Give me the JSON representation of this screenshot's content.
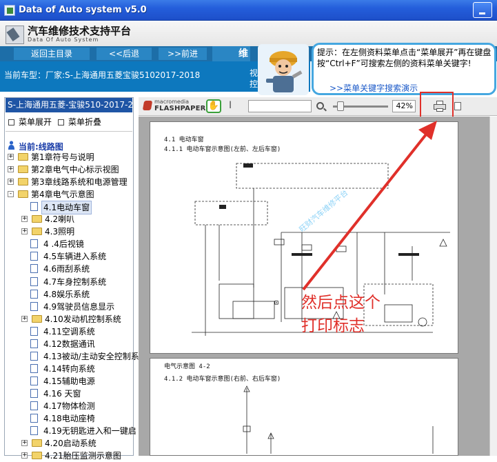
{
  "window": {
    "title": "Data of Auto system v5.0"
  },
  "brand": {
    "title_cn": "汽车维修技术支持平台",
    "title_en": "Data Of Auto System"
  },
  "nav": {
    "home": "返回主目录",
    "back": "<<后退",
    "forward": ">>前进",
    "header_word": "维修"
  },
  "model_line": "当前车型：厂家:S-上海通用五菱宝骏5102017-2018",
  "view_fragment": "视控",
  "tip": {
    "text": "提示：在左侧资料菜单点击“菜单展开”再在键盘按“Ctrl+F”可搜索左侧的资料菜单关键字!",
    "link": ">>菜单关键字搜索演示"
  },
  "left": {
    "header": "S-上海通用五菱-宝骏510-2017-2018",
    "menu_expand": "菜单展开",
    "menu_collapse": "菜单折叠",
    "current": "当前:线路图",
    "tree": [
      {
        "label": "第1章符号与说明",
        "type": "folder",
        "level": 0,
        "exp": "+"
      },
      {
        "label": "第2章电气中心标示视图",
        "type": "folder",
        "level": 0,
        "exp": "+"
      },
      {
        "label": "第3章线路系统和电源管理",
        "type": "folder",
        "level": 0,
        "exp": "+"
      },
      {
        "label": "第4章电气示意图",
        "type": "folder",
        "level": 0,
        "exp": "-"
      },
      {
        "label": "4.1电动车窗",
        "type": "doc",
        "level": 1,
        "selected": true
      },
      {
        "label": "4.2喇叭",
        "type": "folder",
        "level": 1,
        "exp": "+"
      },
      {
        "label": "4.3照明",
        "type": "folder",
        "level": 1,
        "exp": "+"
      },
      {
        "label": "4 .4后视镜",
        "type": "doc",
        "level": 1
      },
      {
        "label": "4.5车辆进入系统",
        "type": "doc",
        "level": 1
      },
      {
        "label": "4.6雨刮系统",
        "type": "doc",
        "level": 1
      },
      {
        "label": "4.7车身控制系统",
        "type": "doc",
        "level": 1
      },
      {
        "label": "4.8娱乐系统",
        "type": "doc",
        "level": 1
      },
      {
        "label": "4.9驾驶员信息显示",
        "type": "doc",
        "level": 1
      },
      {
        "label": "4.10发动机控制系统",
        "type": "folder",
        "level": 1,
        "exp": "+"
      },
      {
        "label": "4.11空调系统",
        "type": "doc",
        "level": 1
      },
      {
        "label": "4.12数据通讯",
        "type": "doc",
        "level": 1
      },
      {
        "label": "4.13被动/主动安全控制系",
        "type": "doc",
        "level": 1
      },
      {
        "label": "4.14转向系统",
        "type": "doc",
        "level": 1
      },
      {
        "label": "4.15辅助电源",
        "type": "doc",
        "level": 1
      },
      {
        "label": "4.16 天窗",
        "type": "doc",
        "level": 1
      },
      {
        "label": "4.17物体检测",
        "type": "doc",
        "level": 1
      },
      {
        "label": "4.18电动座椅",
        "type": "doc",
        "level": 1
      },
      {
        "label": "4.19无钥匙进入和一键启",
        "type": "doc",
        "level": 1
      },
      {
        "label": "4.20启动系统",
        "type": "folder",
        "level": 1,
        "exp": "+"
      },
      {
        "label": "4.21胎压监测示意图",
        "type": "folder",
        "level": 1,
        "exp": "+"
      }
    ]
  },
  "toolbar": {
    "brand_small": "macromedia",
    "brand_big": "FLASHPAPER",
    "hand_icon": "hand-icon",
    "zoom": "42%",
    "zoom_level": 0.08
  },
  "doc": {
    "p1_header": "4.1 电动车窗",
    "p1_sub": "4.1.1 电动车窗示意图(左前、左后车窗)",
    "p2_label": "电气示意图 4-2",
    "p2_sub": "4.1.2 电动车窗示意图(右前、右后车窗)",
    "watermark": "旺财汽车维修平台"
  },
  "annotation": {
    "line1": "然后点这个",
    "line2": "打印标志"
  },
  "colors": {
    "annotation": "#e0302a",
    "titlebar": "#245edb",
    "nav": "#1d6ea8"
  }
}
